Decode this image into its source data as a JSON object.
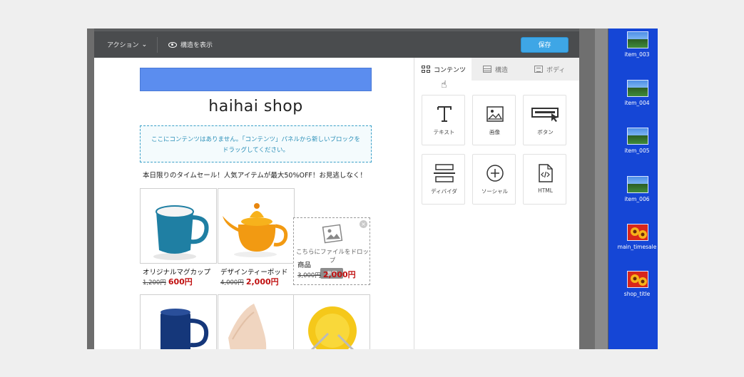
{
  "toolbar": {
    "action_label": "アクション",
    "view_structure_label": "構造を表示",
    "save_label": "保存"
  },
  "canvas": {
    "shop_title": "haihai shop",
    "empty_message_line1": "ここにコンテンツはありません。「コンテンツ」パネルから新しいブロックを",
    "empty_message_line2": "ドラッグしてください。",
    "sale_text": "本日限りのタイムセール！人気アイテムが最大50%OFF！お見逃しなく！",
    "products": [
      {
        "name": "オリジナルマグカップ",
        "old_price": "1,200円",
        "new_price": "600円"
      },
      {
        "name": "デザインティーポッド",
        "old_price": "4,000円",
        "new_price": "2,000円"
      },
      {
        "name": "商品",
        "old_price": "3,000円",
        "new_price": "2,000円"
      }
    ],
    "drop_zone": {
      "line1": "こちらにファイルをドロッ",
      "line2": "プ",
      "button_label": "参照"
    }
  },
  "panel": {
    "tabs": [
      {
        "label": "コンテンツ",
        "active": true
      },
      {
        "label": "構造",
        "active": false
      },
      {
        "label": "ボディ",
        "active": false
      }
    ],
    "blocks": [
      {
        "label": "テキスト",
        "icon": "text-icon"
      },
      {
        "label": "画像",
        "icon": "image-icon"
      },
      {
        "label": "ボタン",
        "icon": "button-icon"
      },
      {
        "label": "ディバイダ",
        "icon": "divider-icon"
      },
      {
        "label": "ソーシャル",
        "icon": "social-icon"
      },
      {
        "label": "HTML",
        "icon": "html-icon"
      }
    ]
  },
  "desktop": {
    "icons": [
      {
        "label": "item_003",
        "icon": "image-file-icon"
      },
      {
        "label": "item_004",
        "icon": "image-file-icon"
      },
      {
        "label": "item_005",
        "icon": "image-file-icon"
      },
      {
        "label": "item_006",
        "icon": "image-file-icon"
      },
      {
        "label": "main_timesale",
        "icon": "image-file-icon"
      },
      {
        "label": "shop_title",
        "icon": "image-file-icon"
      }
    ]
  },
  "colors": {
    "topbar_bg": "#4a4c4e",
    "save_button": "#3ea6e6",
    "banner": "#5b8def",
    "price_red": "#c01010",
    "desktop_blue": "#1546d6"
  }
}
